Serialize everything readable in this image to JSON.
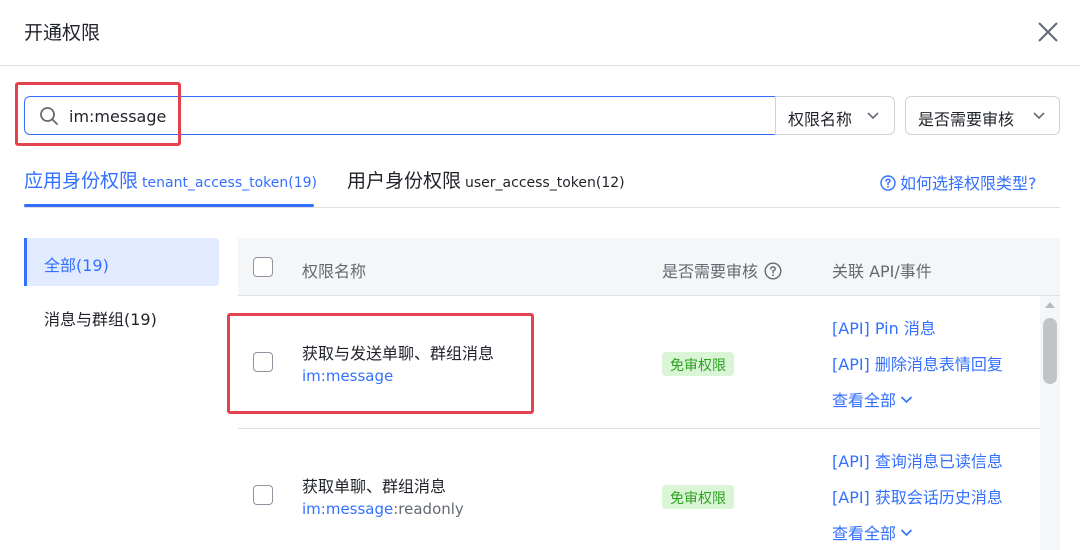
{
  "dialog": {
    "title": "开通权限"
  },
  "search": {
    "value": "im:message"
  },
  "filters": {
    "name_label": "权限名称",
    "review_label": "是否需要审核"
  },
  "tabs": [
    {
      "label": "应用身份权限",
      "sub": "tenant_access_token(19)",
      "active": true
    },
    {
      "label": "用户身份权限",
      "sub": "user_access_token(12)",
      "active": false
    }
  ],
  "help": {
    "label": "如何选择权限类型?"
  },
  "sidebar": {
    "items": [
      {
        "label": "全部(19)",
        "active": true
      },
      {
        "label": "消息与群组(19)",
        "active": false
      }
    ]
  },
  "table": {
    "headers": {
      "name": "权限名称",
      "review": "是否需要审核",
      "api": "关联 API/事件"
    },
    "rows": [
      {
        "name": "获取与发送单聊、群组消息",
        "code_link": "im:message",
        "code_rest": "",
        "badge": "免审权限",
        "apis": [
          "[API] Pin 消息",
          "[API] 删除消息表情回复"
        ],
        "view_all": "查看全部"
      },
      {
        "name": "获取单聊、群组消息",
        "code_link": "im:message",
        "code_rest": ":readonly",
        "badge": "免审权限",
        "apis": [
          "[API] 查询消息已读信息",
          "[API] 获取会话历史消息"
        ],
        "view_all": "查看全部"
      }
    ]
  },
  "colors": {
    "accent": "#3370ff",
    "highlight": "#e4424f",
    "badge_bg": "#d9f5d6",
    "badge_text": "#2ea121"
  }
}
